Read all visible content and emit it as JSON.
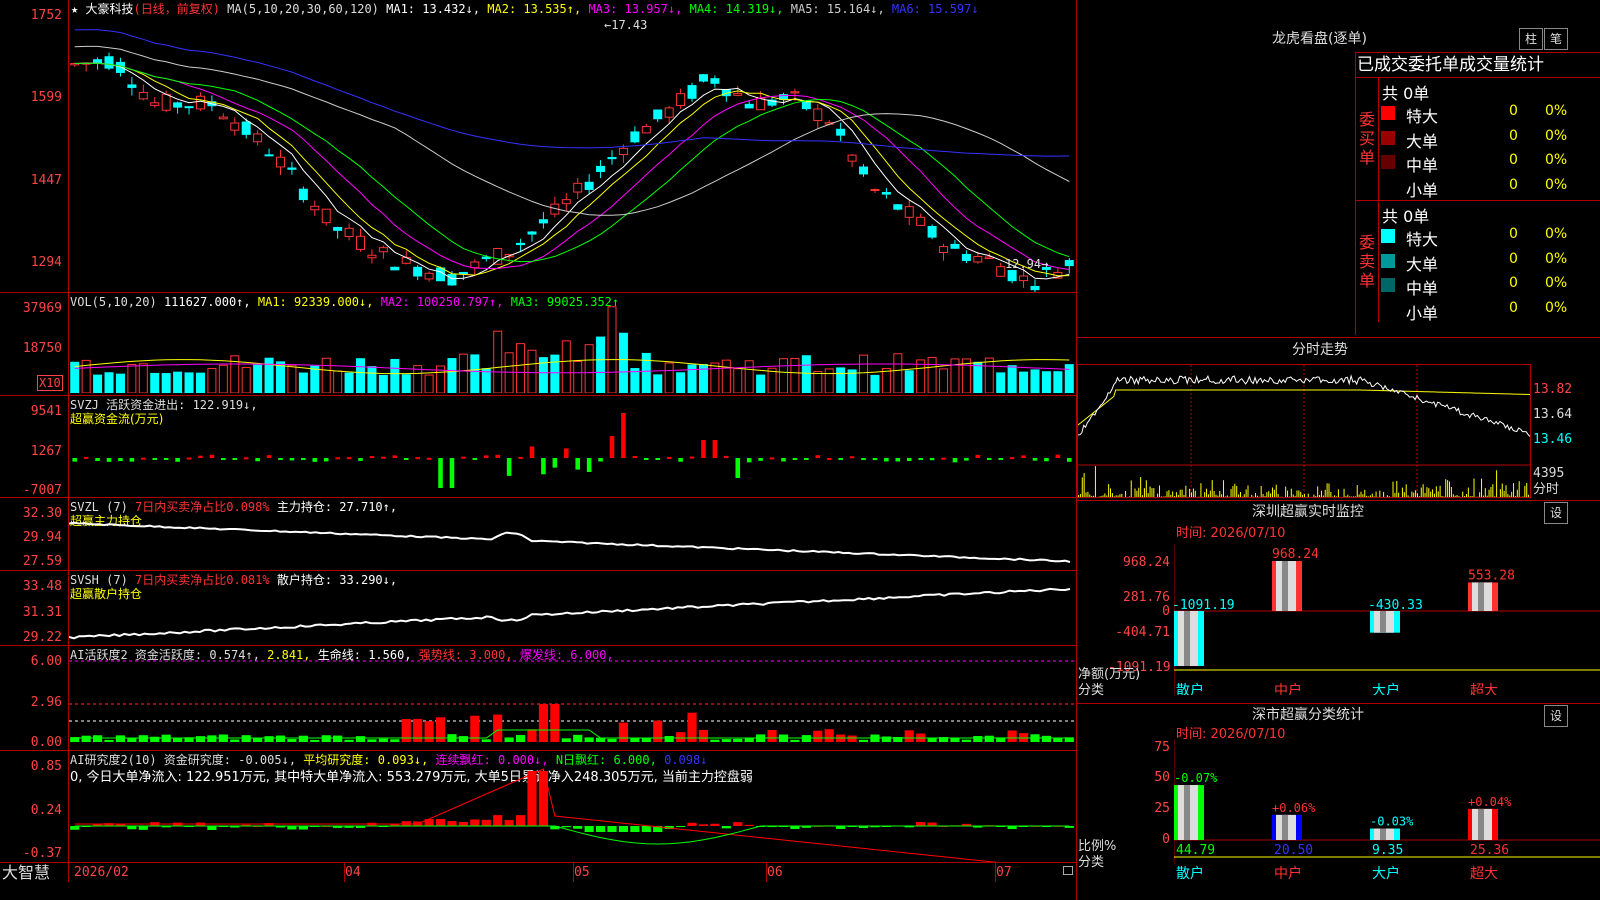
{
  "main_chart": {
    "star": "★",
    "stock_name": "大豪科技",
    "period": "(日线，前复权)",
    "ma_title": "MA(5,10,20,30,60,120)",
    "ma": [
      {
        "label": "MA1:",
        "value": "13.432↓,",
        "color": "#ffffff"
      },
      {
        "label": "MA2:",
        "value": "13.535↑,",
        "color": "#ffff00"
      },
      {
        "label": "MA3:",
        "value": "13.957↓,",
        "color": "#ff00ff"
      },
      {
        "label": "MA4:",
        "value": "14.319↓,",
        "color": "#00ff00"
      },
      {
        "label": "MA5:",
        "value": "15.164↓,",
        "color": "#cccccc"
      },
      {
        "label": "MA6:",
        "value": "15.597↓",
        "color": "#3333ff"
      }
    ],
    "y_labels": [
      "1752",
      "1599",
      "1447",
      "1294"
    ],
    "high_annotation": "←17.43",
    "low_annotation": "12.94→"
  },
  "volume": {
    "title": "VOL(5,10,20)",
    "value": "111627.000↑,",
    "ma1": "MA1: 92339.000↓,",
    "ma2": "MA2: 100250.797↑,",
    "ma3": "MA3: 99025.352↑",
    "y_labels": [
      "37969",
      "18750"
    ],
    "unit": "X10"
  },
  "svzj": {
    "title": "SVZJ  活跃资金进出: 122.919↓,",
    "subtitle": "超赢资金流(万元)",
    "y_labels": [
      "9541",
      "1267",
      "-7007"
    ]
  },
  "svzl": {
    "title": "SVZL (7)",
    "ratio": "7日内买卖净占比0.098%",
    "hold": "主力持仓: 27.710↑,",
    "subtitle": "超赢主力持仓",
    "y_labels": [
      "32.30",
      "29.94",
      "27.59"
    ]
  },
  "svsh": {
    "title": "SVSH (7)",
    "ratio": "7日内买卖净占比0.081%",
    "hold": "散户持仓: 33.290↓,",
    "subtitle": "超赢散户持仓",
    "y_labels": [
      "33.48",
      "31.31",
      "29.22"
    ]
  },
  "ai_active": {
    "title": "AI活跃度2 资金活跃度: 0.574↑,",
    "v2": "2.841,",
    "life": "生命线: 1.560,",
    "strong": "强势线: 3.000,",
    "burst": "爆发线: 6.000,",
    "y_labels": [
      "6.00",
      "2.96",
      "0.00"
    ]
  },
  "ai_research": {
    "title": "AI研究度2(10) 资金研究度: -0.005↓,",
    "avg": "平均研究度: 0.093↓,",
    "red": "连续飘红: 0.000↓,",
    "nred": "N日飘红: 6.000,",
    "last": "0.098↓",
    "text": "0, 今日大单净流入: 122.951万元, 其中特大单净流入: 553.279万元, 大单5日累计净入248.305万元, 当前主力控盘弱",
    "y_labels": [
      "0.85",
      "0.24",
      "-0.37"
    ]
  },
  "x_axis": {
    "brand": "大智慧",
    "labels": [
      "2026/02",
      "04",
      "05",
      "06",
      "07"
    ]
  },
  "dragon_tiger": {
    "title": "龙虎看盘(逐单)",
    "btn_zhu": "柱",
    "btn_bi": "笔",
    "header": "已成交委托单成交量统计",
    "buy_label": "委买单",
    "sell_label": "委卖单",
    "buy_total": "共 0单",
    "sell_total": "共 0单",
    "buy_rows": [
      {
        "name": "特大",
        "count": "0",
        "pct": "0%",
        "color": "#ff0000"
      },
      {
        "name": "大单",
        "count": "0",
        "pct": "0%",
        "color": "#990000"
      },
      {
        "name": "中单",
        "count": "0",
        "pct": "0%",
        "color": "#660000"
      },
      {
        "name": "小单",
        "count": "0",
        "pct": "0%",
        "color": ""
      }
    ],
    "sell_rows": [
      {
        "name": "特大",
        "count": "0",
        "pct": "0%",
        "color": "#00ffff"
      },
      {
        "name": "大单",
        "count": "0",
        "pct": "0%",
        "color": "#009999"
      },
      {
        "name": "中单",
        "count": "0",
        "pct": "0%",
        "color": "#006666"
      },
      {
        "name": "小单",
        "count": "0",
        "pct": "0%",
        "color": ""
      }
    ]
  },
  "intraday": {
    "title": "分时走势",
    "y_labels": [
      "13.82",
      "13.64",
      "13.46"
    ],
    "vol_label": "4395",
    "vol_unit": "分时"
  },
  "sz_monitor": {
    "title": "深圳超赢实时监控",
    "btn": "设",
    "date": "时间: 2026/07/10",
    "y_labels": [
      "968.24",
      "281.76",
      "0",
      "-404.71",
      "-1091.19"
    ],
    "axis_label": "净额(万元)",
    "cat_label": "分类",
    "categories": [
      "散户",
      "中户",
      "大户",
      "超大"
    ],
    "values": [
      -1091.19,
      968.24,
      -430.33,
      553.28
    ],
    "value_labels": [
      "-1091.19",
      "968.24",
      "-430.33",
      "553.28"
    ]
  },
  "sz_class": {
    "title": "深市超赢分类统计",
    "btn": "设",
    "date": "时间: 2026/07/10",
    "y_labels": [
      "75",
      "50",
      "25",
      "0"
    ],
    "axis_label": "比例%",
    "cat_label": "分类",
    "categories": [
      "散户",
      "中户",
      "大户",
      "超大"
    ],
    "values": [
      44.79,
      20.5,
      9.35,
      25.36
    ],
    "change_labels": [
      "-0.07%",
      "+0.06%",
      "-0.03%",
      "+0.04%"
    ],
    "value_labels": [
      "44.79",
      "20.50",
      "9.35",
      "25.36"
    ]
  },
  "chart_data": {
    "type": "candlestick",
    "title": "大豪科技 (日线，前复权)",
    "x": [
      "2026/02",
      "04",
      "05",
      "06",
      "07"
    ],
    "ylim": [
      12.94,
      17.52
    ],
    "high": 17.43,
    "low": 12.94,
    "ma_values": {
      "MA1": 13.432,
      "MA2": 13.535,
      "MA3": 13.957,
      "MA4": 14.319,
      "MA5": 15.164,
      "MA6": 15.597
    }
  }
}
